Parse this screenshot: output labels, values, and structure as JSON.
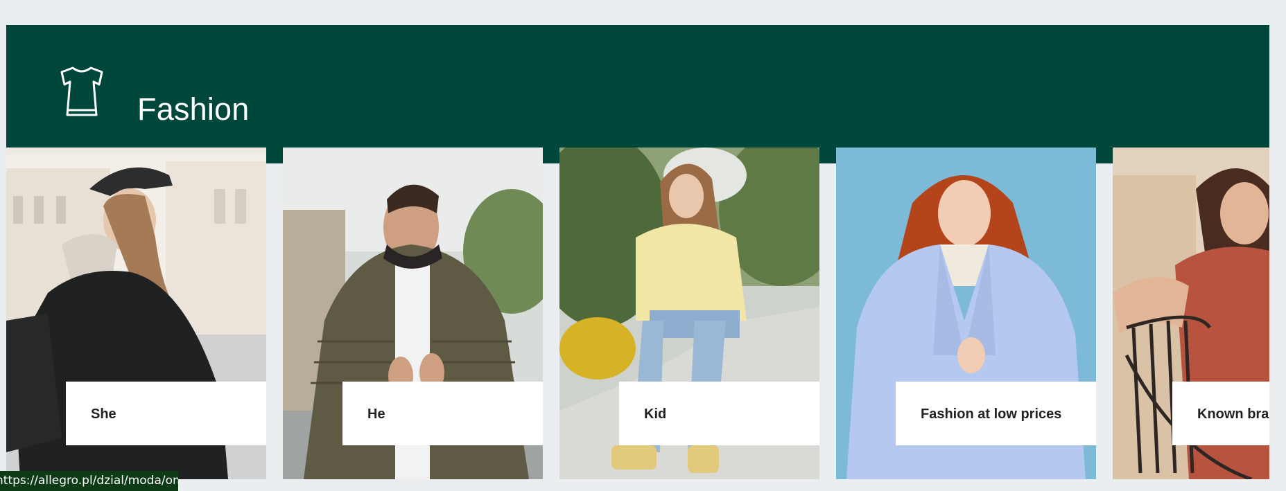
{
  "section": {
    "title": "Fashion",
    "icon": "dress-icon",
    "background": "#00473b"
  },
  "cards": [
    {
      "label": "She"
    },
    {
      "label": "He"
    },
    {
      "label": "Kid"
    },
    {
      "label": "Fashion at low prices"
    },
    {
      "label": "Known brands"
    }
  ],
  "status_bar": {
    "url": "https://allegro.pl/dzial/moda/ona"
  }
}
